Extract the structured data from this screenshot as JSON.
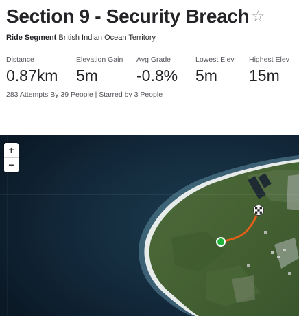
{
  "segment": {
    "title": "Section 9 - Security Breach",
    "star_glyph": "☆",
    "type_label": "Ride Segment",
    "location": "British Indian Ocean Territory"
  },
  "stats": [
    {
      "label": "Distance",
      "value": "0.87km"
    },
    {
      "label": "Elevation Gain",
      "value": "5m"
    },
    {
      "label": "Avg Grade",
      "value": "-0.8%"
    },
    {
      "label": "Lowest Elev",
      "value": "5m"
    },
    {
      "label": "Highest Elev",
      "value": "15m"
    }
  ],
  "attempts_text": "283 Attempts By 39 People | Starred by 3 People",
  "map": {
    "zoom_in_label": "+",
    "zoom_out_label": "−",
    "route_color": "#e0601a",
    "start_color": "#22b33a",
    "end_icon": "checkered-flag-icon"
  }
}
